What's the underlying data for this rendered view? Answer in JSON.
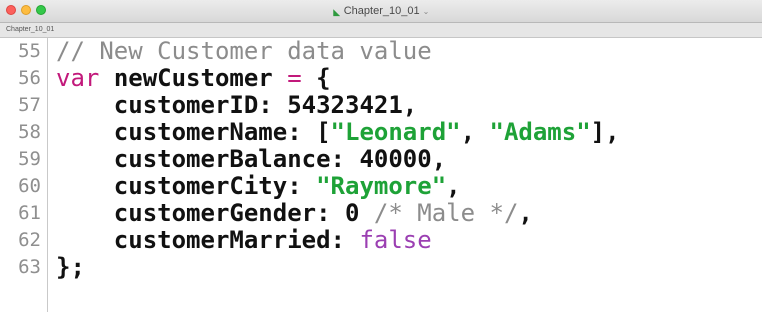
{
  "window": {
    "title": "Chapter_10_01",
    "tab_label": "Chapter_10_01"
  },
  "editor": {
    "line_numbers": [
      "55",
      "56",
      "57",
      "58",
      "59",
      "60",
      "61",
      "62",
      "63"
    ],
    "lines": [
      [
        {
          "t": "// New Customer data value",
          "k": "comment"
        }
      ],
      [
        {
          "t": "var",
          "k": "keyword"
        },
        {
          "t": " ",
          "k": "plain"
        },
        {
          "t": "newCustomer",
          "k": "ident"
        },
        {
          "t": " ",
          "k": "plain"
        },
        {
          "t": "=",
          "k": "op"
        },
        {
          "t": " ",
          "k": "plain"
        },
        {
          "t": "{",
          "k": "punct"
        }
      ],
      [
        {
          "t": "    ",
          "k": "plain"
        },
        {
          "t": "customerID:",
          "k": "ident"
        },
        {
          "t": " ",
          "k": "plain"
        },
        {
          "t": "54323421",
          "k": "number"
        },
        {
          "t": ",",
          "k": "punct"
        }
      ],
      [
        {
          "t": "    ",
          "k": "plain"
        },
        {
          "t": "customerName:",
          "k": "ident"
        },
        {
          "t": " ",
          "k": "plain"
        },
        {
          "t": "[",
          "k": "punct"
        },
        {
          "t": "\"Leonard\"",
          "k": "string"
        },
        {
          "t": ", ",
          "k": "punct"
        },
        {
          "t": "\"Adams\"",
          "k": "string"
        },
        {
          "t": "],",
          "k": "punct"
        }
      ],
      [
        {
          "t": "    ",
          "k": "plain"
        },
        {
          "t": "customerBalance:",
          "k": "ident"
        },
        {
          "t": " ",
          "k": "plain"
        },
        {
          "t": "40000",
          "k": "number"
        },
        {
          "t": ",",
          "k": "punct"
        }
      ],
      [
        {
          "t": "    ",
          "k": "plain"
        },
        {
          "t": "customerCity:",
          "k": "ident"
        },
        {
          "t": " ",
          "k": "plain"
        },
        {
          "t": "\"Raymore\"",
          "k": "string"
        },
        {
          "t": ",",
          "k": "punct"
        }
      ],
      [
        {
          "t": "    ",
          "k": "plain"
        },
        {
          "t": "customerGender:",
          "k": "ident"
        },
        {
          "t": " ",
          "k": "plain"
        },
        {
          "t": "0",
          "k": "number"
        },
        {
          "t": " ",
          "k": "plain"
        },
        {
          "t": "/* Male */",
          "k": "comment"
        },
        {
          "t": ",",
          "k": "punct"
        }
      ],
      [
        {
          "t": "    ",
          "k": "plain"
        },
        {
          "t": "customerMarried:",
          "k": "ident"
        },
        {
          "t": " ",
          "k": "plain"
        },
        {
          "t": "false",
          "k": "bool"
        }
      ],
      [
        {
          "t": "};",
          "k": "punct"
        }
      ]
    ]
  },
  "colors": {
    "keyword": "#c2197b",
    "string": "#1ea237",
    "boolean": "#9b3fb2",
    "comment": "#8c8c8c"
  },
  "icons": {
    "document": "document-icon",
    "dropdown": "chevron-down-icon"
  }
}
